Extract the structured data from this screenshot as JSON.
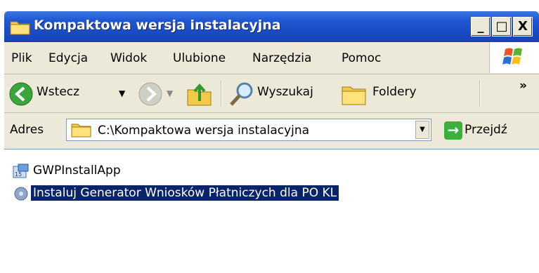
{
  "window": {
    "title": "Kompaktowa wersja instalacyjna"
  },
  "title_controls": {
    "minimize": "_",
    "maximize": "□",
    "close": "X"
  },
  "menu": [
    "Plik",
    "Edycja",
    "Widok",
    "Ulubione",
    "Narzędzia",
    "Pomoc"
  ],
  "toolbar": {
    "back": "Wstecz",
    "search": "Wyszukaj",
    "folders": "Foldery",
    "more": "»"
  },
  "address": {
    "label": "Adres",
    "value": "C:\\Kompaktowa wersja instalacyjna",
    "go": "Przejdź"
  },
  "files": [
    {
      "name": "GWPInstallApp",
      "icon": "app-icon",
      "selected": false
    },
    {
      "name": "Instaluj Generator Wniosków Płatniczych dla PO KL",
      "icon": "installer-icon",
      "selected": true
    }
  ],
  "colors": {
    "title_bar": "#2056d3",
    "selection": "#0a246a",
    "window_bg": "#ece9d8"
  }
}
